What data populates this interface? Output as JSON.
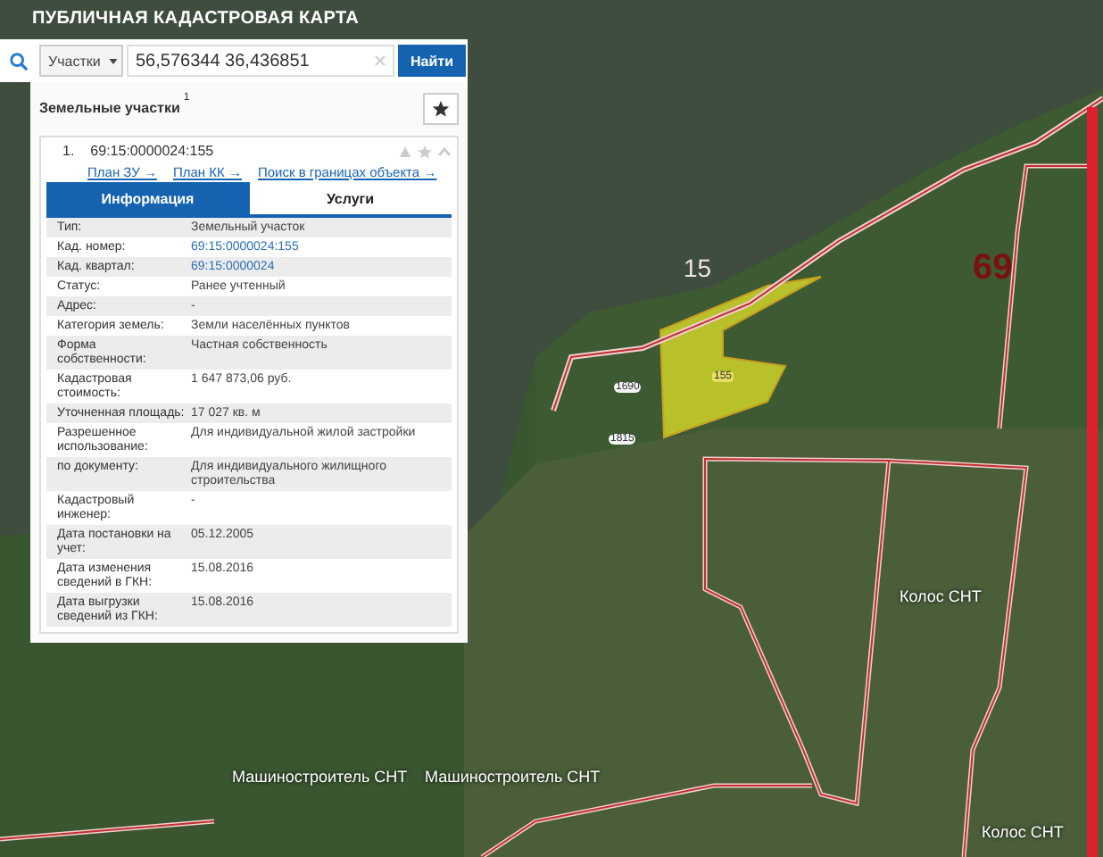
{
  "header": {
    "title": "ПУБЛИЧНАЯ КАДАСТРОВАЯ КАРТА"
  },
  "search": {
    "type_dropdown": "Участки",
    "value": "56,576344 36,436851",
    "button": "Найти"
  },
  "panel": {
    "title": "Земельные участки",
    "count": "1",
    "result": {
      "index": "1.",
      "number": "69:15:0000024:155",
      "links": [
        "План ЗУ →",
        "План КК →",
        "Поиск в границах объекта →"
      ],
      "tabs": [
        {
          "label": "Информация",
          "selected": true
        },
        {
          "label": "Услуги",
          "selected": false
        }
      ],
      "rows": [
        {
          "label": "Тип:",
          "value": "Земельный участок",
          "link": false
        },
        {
          "label": "Кад. номер:",
          "value": "69:15:0000024:155",
          "link": true
        },
        {
          "label": "Кад. квартал:",
          "value": "69:15:0000024",
          "link": true
        },
        {
          "label": "Статус:",
          "value": "Ранее учтенный",
          "link": false
        },
        {
          "label": "Адрес:",
          "value": "-",
          "link": false
        },
        {
          "label": "Категория земель:",
          "value": "Земли населённых пунктов",
          "link": false
        },
        {
          "label": "Форма собственности:",
          "value": "Частная собственность",
          "link": false
        },
        {
          "label": "Кадастровая стоимость:",
          "value": "1 647 873,06 руб.",
          "link": false
        },
        {
          "label": "Уточненная площадь:",
          "value": "17 027 кв. м",
          "link": false
        },
        {
          "label": "Разрешенное использование:",
          "value": "Для индивидуальной жилой застройки",
          "link": false
        },
        {
          "label": "по документу:",
          "value": "Для индивидуального жилищного строительства",
          "link": false
        },
        {
          "label": "Кадастровый инженер:",
          "value": "-",
          "link": false
        },
        {
          "label": "Дата постановки на учет:",
          "value": "05.12.2005",
          "link": false
        },
        {
          "label": "Дата изменения сведений в ГКН:",
          "value": "15.08.2016",
          "link": false
        },
        {
          "label": "Дата выгрузки сведений из ГКН:",
          "value": "15.08.2016",
          "link": false
        }
      ]
    }
  },
  "map_labels": [
    {
      "text": "15",
      "kind": "quarter"
    },
    {
      "text": "69",
      "kind": "district"
    },
    {
      "text": "155",
      "kind": "selected"
    },
    {
      "text": "1690",
      "kind": "parcel"
    },
    {
      "text": "1815",
      "kind": "parcel"
    },
    {
      "text": "Колос СНТ",
      "kind": "settlement"
    },
    {
      "text": "Машиностроитель СНТ",
      "kind": "settlement"
    },
    {
      "text": "Машиностроитель СНТ",
      "kind": "settlement"
    },
    {
      "text": "Колос СНТ",
      "kind": "settlement"
    }
  ]
}
